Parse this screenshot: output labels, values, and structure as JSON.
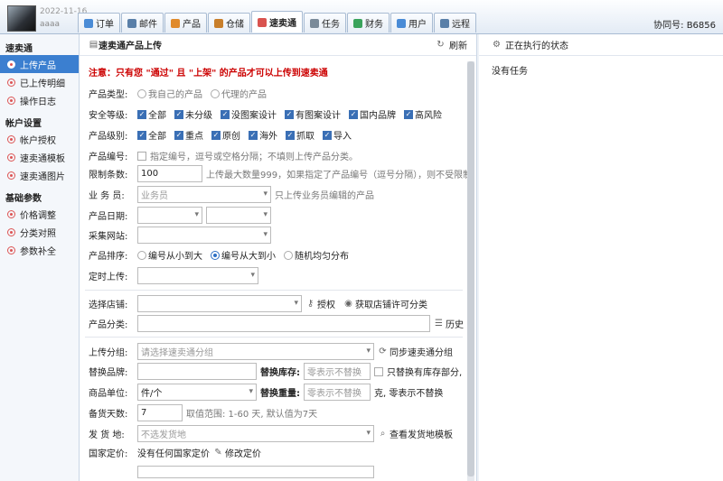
{
  "header": {
    "date": "2022-11-16",
    "username": "aaaa",
    "account": "协同号: B6856"
  },
  "tabs": [
    {
      "label": "订单",
      "icon": "order-icon",
      "color": "#4a8bd6"
    },
    {
      "label": "邮件",
      "icon": "mail-icon",
      "color": "#5a7fa8"
    },
    {
      "label": "产品",
      "icon": "product-icon",
      "color": "#e08a2c"
    },
    {
      "label": "仓储",
      "icon": "warehouse-icon",
      "color": "#c87e2a"
    },
    {
      "label": "速卖通",
      "icon": "aliexpress-icon",
      "color": "#d9534f",
      "active": true
    },
    {
      "label": "任务",
      "icon": "task-icon",
      "color": "#7a8a99"
    },
    {
      "label": "财务",
      "icon": "finance-icon",
      "color": "#3aa35b"
    },
    {
      "label": "用户",
      "icon": "user-icon",
      "color": "#4a8bd6"
    },
    {
      "label": "远程",
      "icon": "remote-icon",
      "color": "#5a7fa8"
    }
  ],
  "sidebar": {
    "groups": [
      {
        "title": "速卖通",
        "items": [
          "上传产品",
          "已上传明细",
          "操作日志"
        ]
      },
      {
        "title": "帐户设置",
        "items": [
          "帐户授权",
          "速卖通模板",
          "速卖通图片"
        ]
      },
      {
        "title": "基础参数",
        "items": [
          "价格调整",
          "分类对照",
          "参数补全"
        ]
      }
    ]
  },
  "main": {
    "title": "速卖通产品上传",
    "refresh": "刷新",
    "notice": "注意：只有您 \"通过\" 且 \"上架\" 的产品才可以上传到速卖通",
    "product_type": {
      "label": "产品类型:",
      "options": [
        "我自己的产品",
        "代理的产品"
      ]
    },
    "security": {
      "label": "安全等级:",
      "options": [
        "全部",
        "未分级",
        "没图案设计",
        "有图案设计",
        "国内品牌",
        "高风险"
      ]
    },
    "level": {
      "label": "产品级别:",
      "options": [
        "全部",
        "重点",
        "原创",
        "海外",
        "抓取",
        "导入"
      ]
    },
    "code": {
      "label": "产品编号:",
      "hint": "指定编号，逗号或空格分隔；不填则上传产品分类。"
    },
    "limit": {
      "label": "限制条数:",
      "value": "100",
      "hint": "上传最大数量999，如果指定了产品编号（逗号分隔），则不受限制"
    },
    "salesman": {
      "label": "业 务 员:",
      "placeholder": "业务员",
      "hint": "只上传业务员编辑的产品"
    },
    "date": {
      "label": "产品日期:"
    },
    "site": {
      "label": "采集网站:"
    },
    "sort": {
      "label": "产品排序:",
      "options": [
        "编号从小到大",
        "编号从大到小",
        "随机均匀分布"
      ]
    },
    "timer": {
      "label": "定时上传:"
    },
    "store": {
      "label": "选择店铺:",
      "auth": "授权",
      "fetch": "获取店铺许可分类"
    },
    "category": {
      "label": "产品分类:",
      "history": "历史"
    },
    "group": {
      "label": "上传分组:",
      "placeholder": "请选择速卖通分组",
      "sync": "同步速卖通分组"
    },
    "brand": {
      "label": "替换品牌:"
    },
    "stock": {
      "label": "替换库存:",
      "placeholder": "零表示不替换",
      "check": "只替换有库存部分,"
    },
    "unit": {
      "label": "商品单位:",
      "value": "件/个"
    },
    "weight": {
      "label": "替换重量:",
      "placeholder": "零表示不替换",
      "hint": "克, 零表示不替换"
    },
    "days": {
      "label": "备货天数:",
      "value": "7",
      "hint": "取值范围: 1-60 天, 默认值为7天"
    },
    "ship": {
      "label": "发 货 地:",
      "placeholder": "不选发货地",
      "view": "查看发货地模板"
    },
    "country": {
      "label": "国家定价:",
      "value": "没有任何国家定价",
      "edit": "修改定价"
    }
  },
  "right": {
    "title": "正在执行的状态",
    "empty": "没有任务"
  }
}
